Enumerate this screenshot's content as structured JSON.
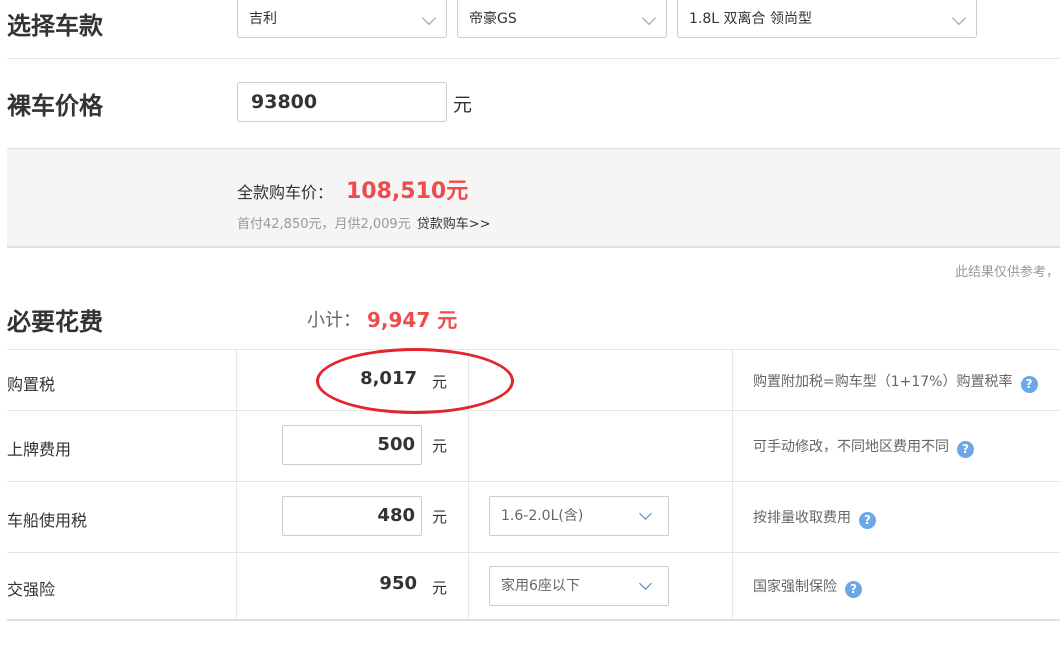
{
  "select_car": {
    "heading": "选择车款",
    "brand": "吉利",
    "model": "帝豪GS",
    "trim": "1.8L 双离合 领尚型"
  },
  "bare_price": {
    "heading": "裸车价格",
    "value": "93800",
    "unit": "元"
  },
  "summary": {
    "total_label": "全款购车价：",
    "total_value": "108,510元",
    "sub_text": "首付42,850元，月供2,009元",
    "loan_link": "贷款购车>>"
  },
  "note": "此结果仅供参考，",
  "required": {
    "heading": "必要花费",
    "subtotal_label": "小计：",
    "subtotal_value": "9,947 元",
    "unit": "元",
    "rows": [
      {
        "label": "购置税",
        "value": "8,017",
        "desc": "购置附加税=购车型（1+17%）购置税率"
      },
      {
        "label": "上牌费用",
        "value": "500",
        "desc": "可手动修改，不同地区费用不同"
      },
      {
        "label": "车船使用税",
        "value": "480",
        "select": "1.6-2.0L(含)",
        "desc": "按排量收取费用"
      },
      {
        "label": "交强险",
        "value": "950",
        "select": "家用6座以下",
        "desc": "国家强制保险"
      }
    ]
  },
  "help_icon": "?",
  "colors": {
    "accent_red": "#f04b4b",
    "help_blue": "#6ca8e8",
    "highlight_circle": "#e3262b"
  }
}
